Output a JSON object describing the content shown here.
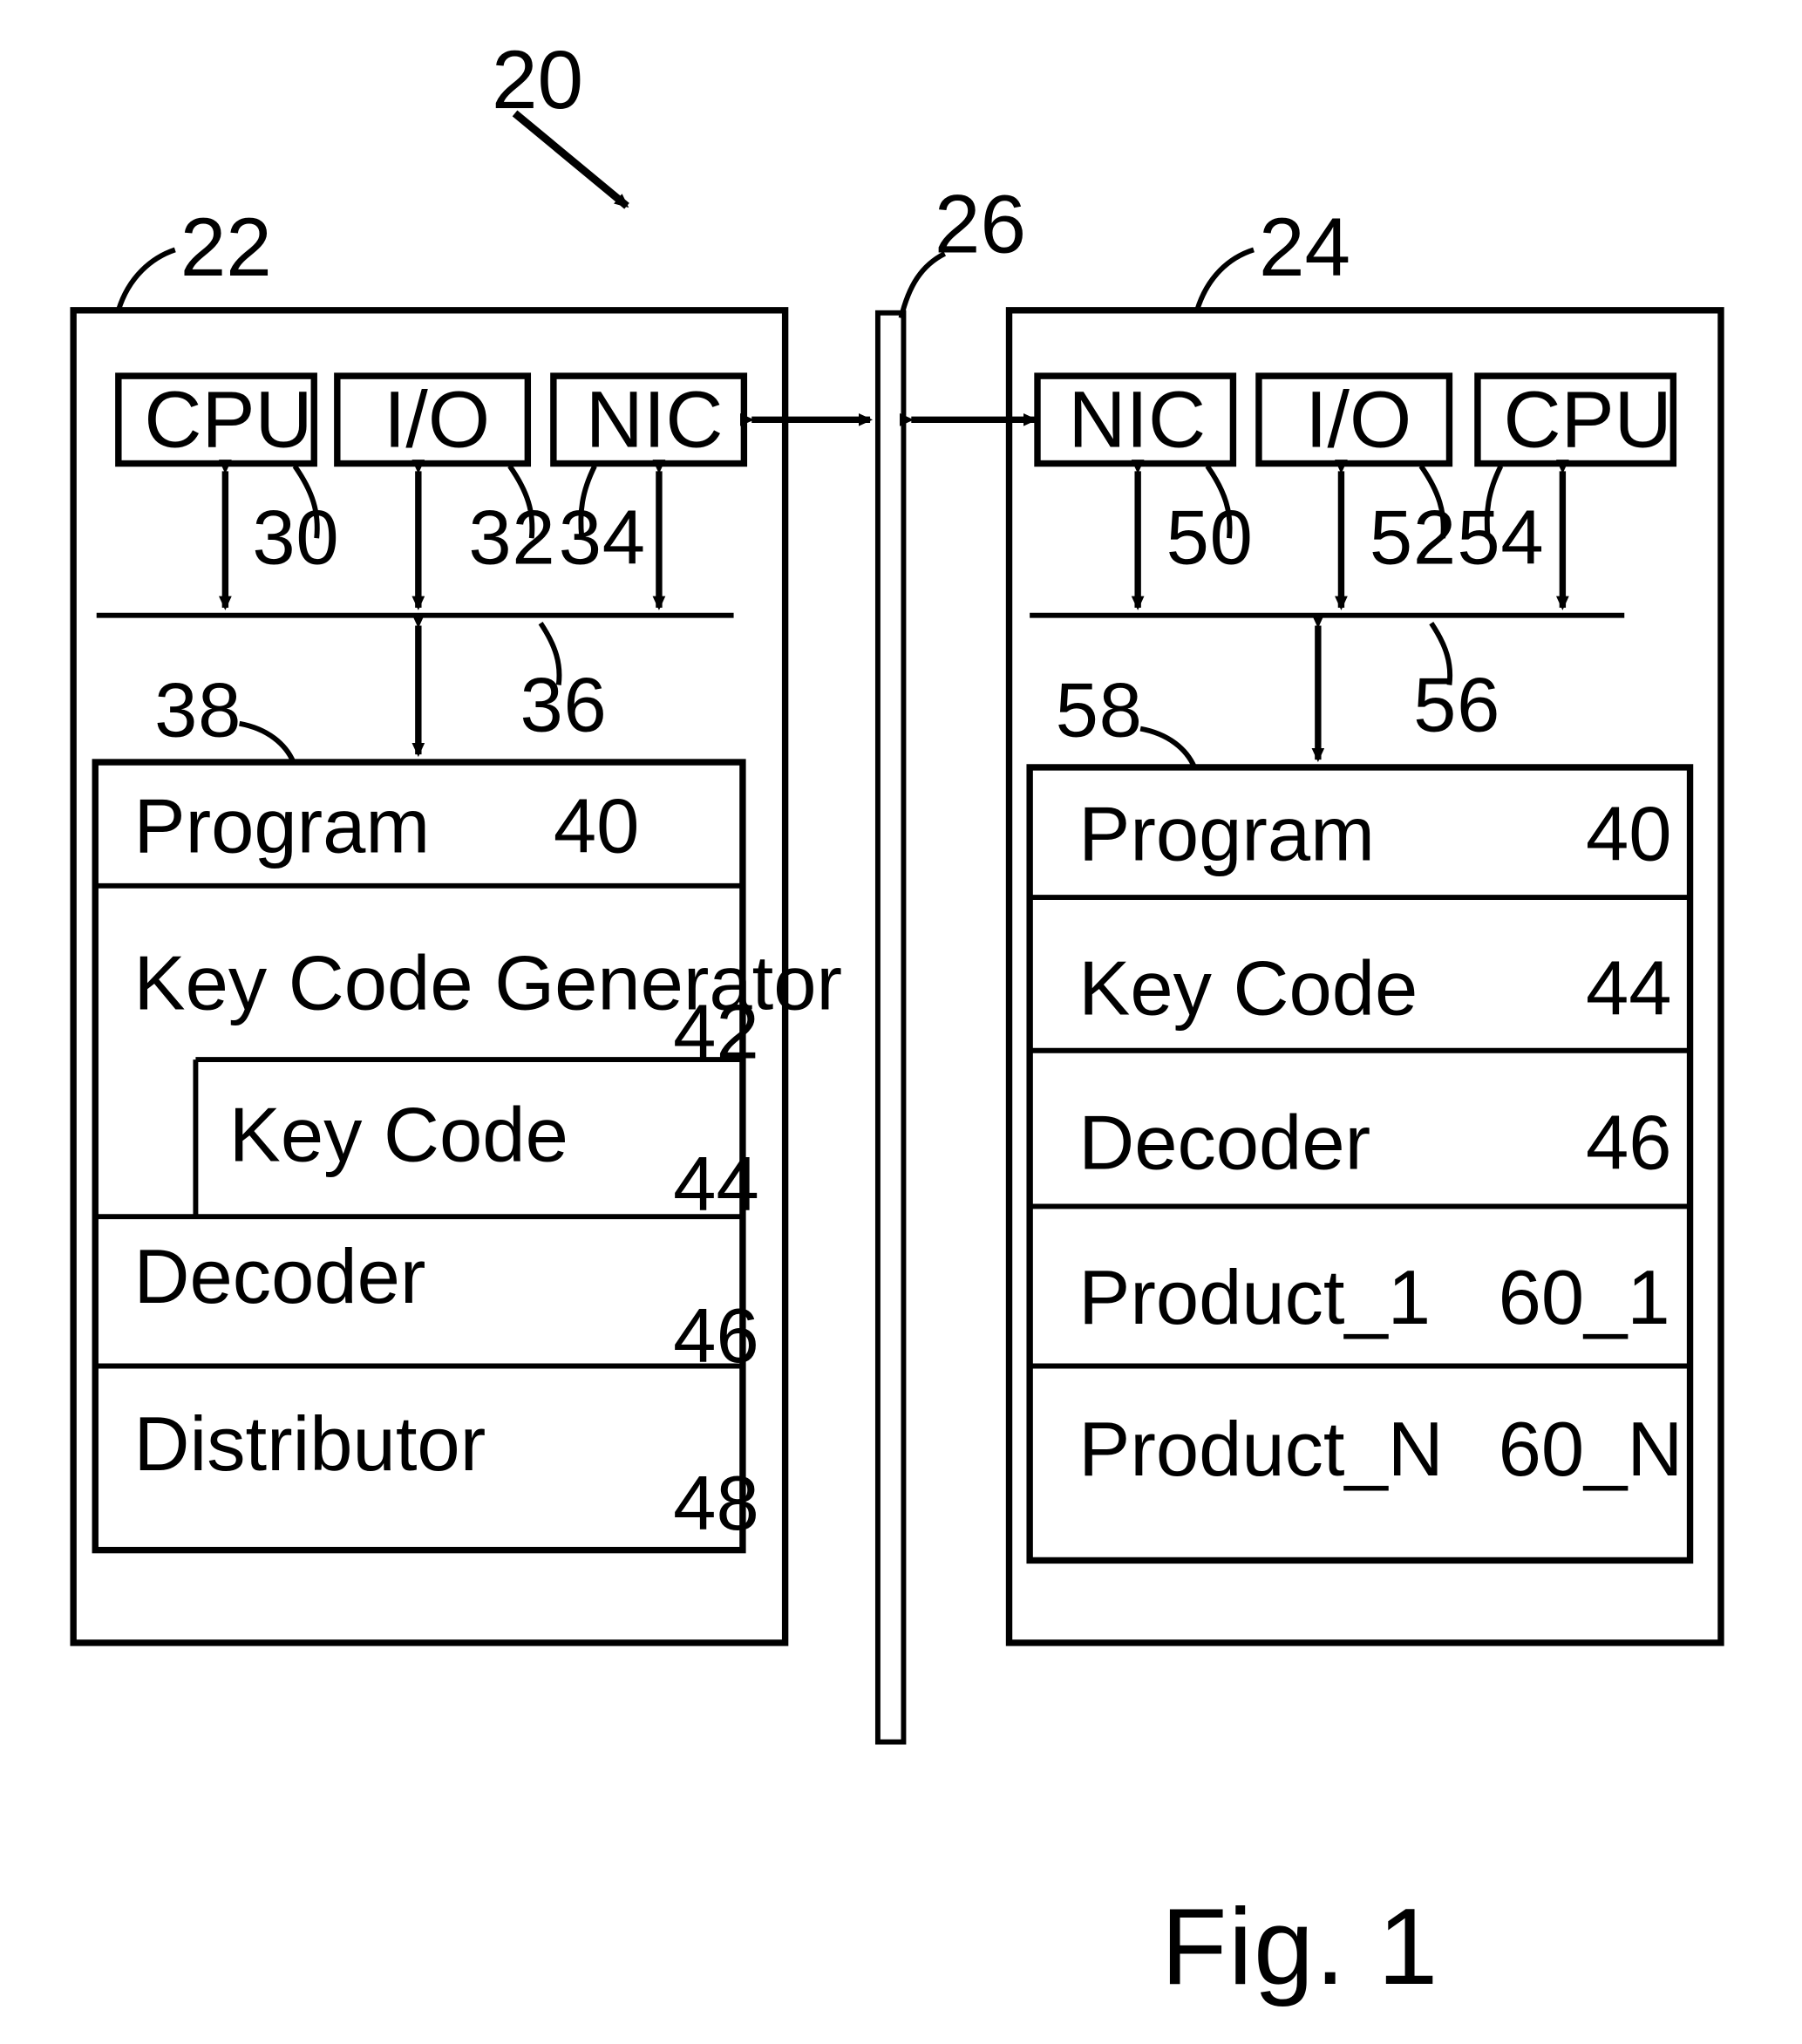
{
  "figure": {
    "caption": "Fig. 1",
    "system_numeral": "20"
  },
  "left_system": {
    "numeral": "22",
    "hardware": [
      {
        "label": "CPU",
        "bus_numeral": "30"
      },
      {
        "label": "I/O",
        "bus_numeral": "32"
      },
      {
        "label": "NIC",
        "bus_numeral": "34"
      }
    ],
    "bus_numeral": "36",
    "memory_numeral": "38",
    "modules": [
      {
        "label": "Program",
        "numeral": "40"
      },
      {
        "label": "Key Code Generator",
        "numeral": "42"
      },
      {
        "label": "Key Code",
        "numeral": "44"
      },
      {
        "label": "Decoder",
        "numeral": "46"
      },
      {
        "label": "Distributor",
        "numeral": "48"
      }
    ]
  },
  "network": {
    "numeral": "26"
  },
  "right_system": {
    "numeral": "24",
    "hardware": [
      {
        "label": "NIC",
        "bus_numeral": "50"
      },
      {
        "label": "I/O",
        "bus_numeral": "52"
      },
      {
        "label": "CPU",
        "bus_numeral": "54"
      }
    ],
    "bus_numeral": "56",
    "memory_numeral": "58",
    "modules": [
      {
        "label": "Program",
        "numeral": "40"
      },
      {
        "label": "Key Code",
        "numeral": "44"
      },
      {
        "label": "Decoder",
        "numeral": "46"
      },
      {
        "label": "Product_1",
        "numeral": "60_1"
      },
      {
        "label": "Product_N",
        "numeral": "60_N"
      }
    ]
  }
}
